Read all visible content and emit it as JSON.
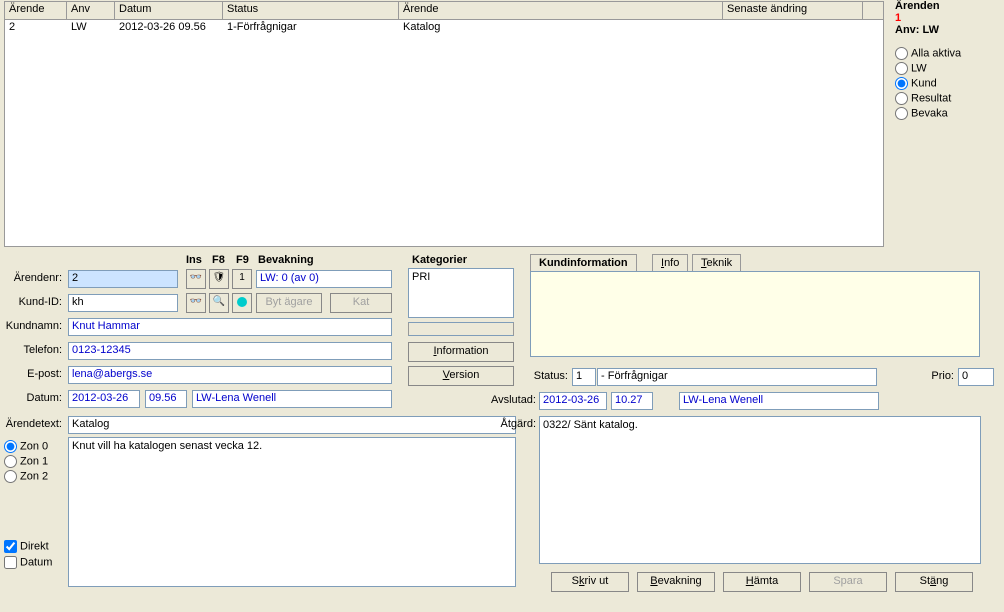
{
  "grid": {
    "headers": [
      "Ärende",
      "Anv",
      "Datum",
      "Status",
      "Ärende",
      "Senaste ändring"
    ],
    "rows": [
      {
        "arende": "2",
        "anv": "LW",
        "datum": "2012-03-26 09.56",
        "status": "1-Förfrågnigar",
        "arende2": "Katalog",
        "senaste": ""
      }
    ]
  },
  "filters": {
    "title": "Ärenden",
    "count": "1",
    "anv_label": "Anv: LW",
    "opts": [
      "Alla aktiva",
      "LW",
      "Kund",
      "Resultat",
      "Bevaka"
    ],
    "selected": "Kund"
  },
  "toolbar": {
    "ins": "Ins",
    "f8": "F8",
    "f9": "F9",
    "bevak": "Bevakning",
    "byt": "Byt ägare",
    "kat": "Kat",
    "one": "1",
    "lw0": "LW: 0  (av 0)"
  },
  "fields": {
    "arendenr_lbl": "Ärendenr:",
    "arendenr": "2",
    "kundid_lbl": "Kund-ID:",
    "kundid": "kh",
    "kundnamn_lbl": "Kundnamn:",
    "kundnamn": "Knut Hammar",
    "telefon_lbl": "Telefon:",
    "telefon": "0123-12345",
    "epost_lbl": "E-post:",
    "epost": "lena@abergs.se",
    "datum_lbl": "Datum:",
    "datum": "2012-03-26",
    "tid": "09.56",
    "user": "LW-Lena Wenell",
    "arendetext_lbl": "Ärendetext:",
    "arendetext_head": "Katalog",
    "arendetext_body": "Knut vill ha katalogen senast vecka 12."
  },
  "zon": {
    "z0": "Zon 0",
    "z1": "Zon 1",
    "z2": "Zon 2"
  },
  "chk": {
    "direkt": "Direkt",
    "datum": "Datum"
  },
  "mid": {
    "kategorier": "Kategorier",
    "pri": "PRI",
    "info_btn": "Information",
    "ver_btn": "Version"
  },
  "right": {
    "kundinfo": "Kundinformation",
    "info_tab": "Info",
    "teknik_tab": "Teknik",
    "status_lbl": "Status:",
    "status_num": "1",
    "status_txt": "- Förfrågnigar",
    "prio_lbl": "Prio:",
    "prio": "0",
    "avslutad_lbl": "Avslutad:",
    "avslutad_d": "2012-03-26",
    "avslutad_t": "10.27",
    "avslutad_u": "LW-Lena Wenell",
    "atgard_lbl": "Åtgärd:",
    "atgard": "0322/ Sänt katalog."
  },
  "bottom": {
    "skriv": "Skriv ut",
    "bevak": "Bevakning",
    "hamta": "Hämta",
    "spara": "Spara",
    "stang": "Stäng"
  }
}
